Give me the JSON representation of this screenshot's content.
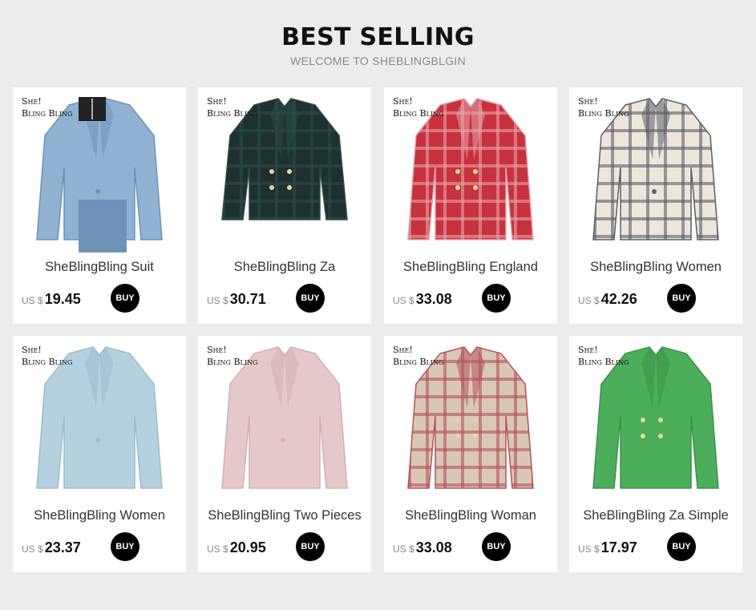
{
  "header": {
    "title": "BEST SELLING",
    "subtitle": "WELCOME TO SHEBLINGBLGIN"
  },
  "brand_logo": {
    "line1": "She!",
    "line2": "Bling Bling"
  },
  "products": [
    {
      "name": "SheBlingBling Suit",
      "currency": "US $",
      "price": "19.45",
      "buy_label": "BUY",
      "image": "model in light blue blazer suit",
      "colors": [
        "#8fb1d2",
        "#6f93b8"
      ]
    },
    {
      "name": "SheBlingBling Za",
      "currency": "US $",
      "price": "30.71",
      "buy_label": "BUY",
      "image": "dark green plaid cropped blazer",
      "colors": [
        "#1e3131",
        "#2c4a49"
      ]
    },
    {
      "name": "SheBlingBling England",
      "currency": "US $",
      "price": "33.08",
      "buy_label": "BUY",
      "image": "red plaid double-breasted blazer",
      "colors": [
        "#c7323e",
        "#e5a3a8"
      ]
    },
    {
      "name": "SheBlingBling Women",
      "currency": "US $",
      "price": "42.26",
      "buy_label": "BUY",
      "image": "cream plaid blazer",
      "colors": [
        "#ece7da",
        "#5e5e6a"
      ]
    },
    {
      "name": "SheBlingBling Women",
      "currency": "US $",
      "price": "23.37",
      "buy_label": "BUY",
      "image": "light blue blazer",
      "colors": [
        "#b5d1e0",
        "#9bbccd"
      ]
    },
    {
      "name": "SheBlingBling Two Pieces",
      "currency": "US $",
      "price": "20.95",
      "buy_label": "BUY",
      "image": "pink blazer",
      "colors": [
        "#e5c9ca",
        "#d3b0b2"
      ]
    },
    {
      "name": "SheBlingBling Woman",
      "currency": "US $",
      "price": "33.08",
      "buy_label": "BUY",
      "image": "beige and red tweed plaid blazer",
      "colors": [
        "#d9c8b6",
        "#b5545a"
      ]
    },
    {
      "name": "SheBlingBling Za Simple",
      "currency": "US $",
      "price": "17.97",
      "buy_label": "BUY",
      "image": "green tweed blazer",
      "colors": [
        "#4cae5a",
        "#3b9348"
      ]
    }
  ]
}
